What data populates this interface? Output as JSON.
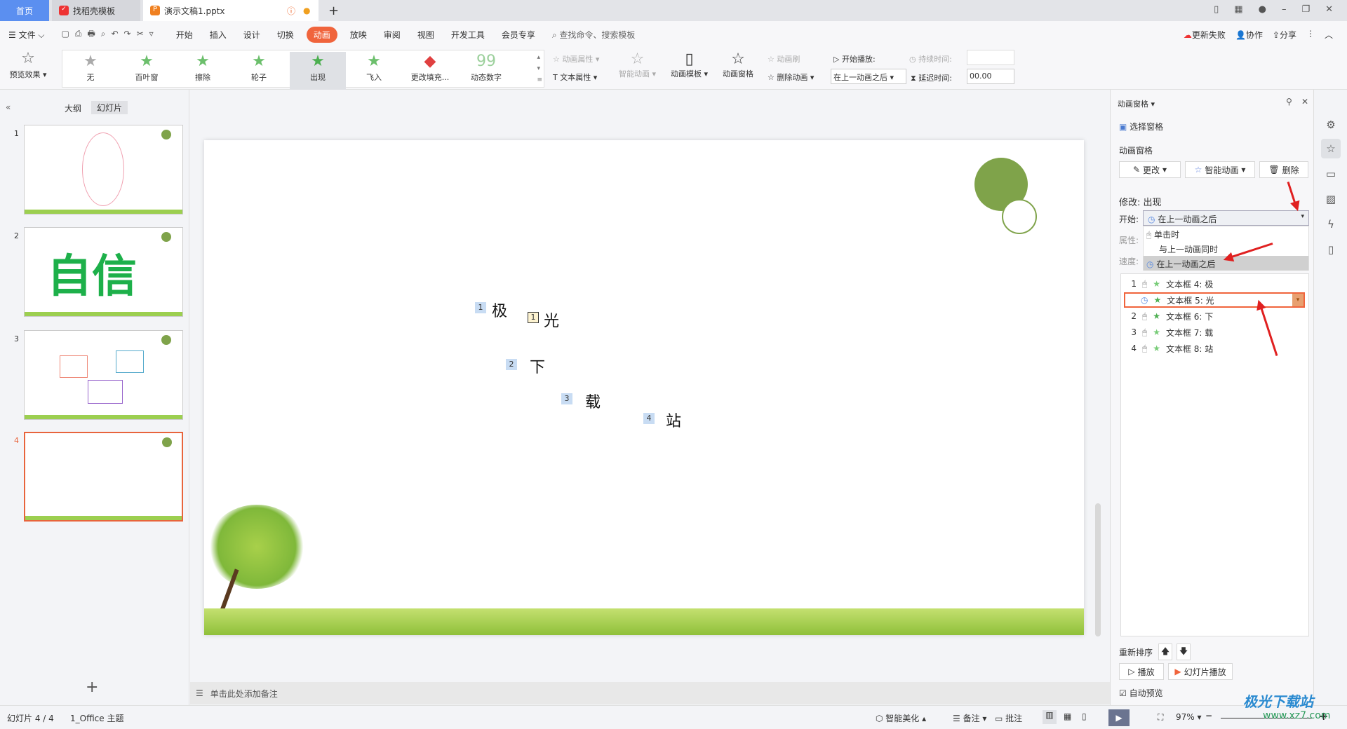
{
  "tabs": [
    {
      "label": "首页"
    },
    {
      "label": "找稻壳模板"
    },
    {
      "label": "演示文稿1.pptx"
    }
  ],
  "menu": {
    "file": "文件",
    "items": [
      "开始",
      "插入",
      "设计",
      "切换",
      "动画",
      "放映",
      "审阅",
      "视图",
      "开发工具",
      "会员专享"
    ],
    "active": "动画",
    "search_placeholder": "查找命令、搜索模板",
    "update": "更新失败",
    "collab": "协作",
    "share": "分享"
  },
  "ribbon": {
    "preview": "预览效果",
    "effects": [
      {
        "label": "无",
        "icon": "star-grey"
      },
      {
        "label": "百叶窗",
        "icon": "star-green"
      },
      {
        "label": "擦除",
        "icon": "star-green"
      },
      {
        "label": "轮子",
        "icon": "star-green"
      },
      {
        "label": "出现",
        "icon": "star-green"
      },
      {
        "label": "飞入",
        "icon": "star-green"
      },
      {
        "label": "更改填充...",
        "icon": "fill"
      },
      {
        "label": "动态数字",
        "icon": "99"
      }
    ],
    "anim_props": "动画属性",
    "text_props": "文本属性",
    "smart_anim": "智能动画",
    "anim_template": "动画模板",
    "anim_pane": "动画窗格",
    "anim_brush": "动画刷",
    "delete_anim": "删除动画",
    "start_play": "开始播放:",
    "start_value": "在上一动画之后",
    "duration": "持续时间:",
    "delay": "延迟时间:",
    "delay_value": "00.00"
  },
  "left": {
    "tab_outline": "大纲",
    "tab_slides": "幻灯片",
    "slides": [
      "1",
      "2",
      "3",
      "4"
    ],
    "slide2_text": "自信",
    "selected": 4
  },
  "slide": {
    "chars": [
      "极",
      "光",
      "下",
      "载",
      "站"
    ],
    "badges": [
      "1",
      "1",
      "2",
      "3",
      "4"
    ]
  },
  "notes_placeholder": "单击此处添加备注",
  "status": {
    "slide": "幻灯片 4 / 4",
    "theme": "1_Office 主题",
    "beautify": "智能美化",
    "notes": "备注",
    "comment": "批注",
    "zoom": "97%"
  },
  "pane": {
    "title": "动画窗格",
    "select_pane": "选择窗格",
    "section": "动画窗格",
    "change": "更改",
    "smart": "智能动画",
    "delete": "删除",
    "modify": "修改: 出现",
    "start_label": "开始:",
    "start_value": "在上一动画之后",
    "prop_label": "属性:",
    "speed_label": "速度:",
    "options": [
      "单击时",
      "与上一动画同时",
      "在上一动画之后"
    ],
    "list": [
      {
        "num": "1",
        "trigger": "click",
        "name": "文本框 4: 极"
      },
      {
        "num": "",
        "trigger": "after",
        "name": "文本框 5: 光"
      },
      {
        "num": "2",
        "trigger": "click",
        "name": "文本框 6: 下"
      },
      {
        "num": "3",
        "trigger": "click",
        "name": "文本框 7: 载"
      },
      {
        "num": "4",
        "trigger": "click",
        "name": "文本框 8: 站"
      }
    ],
    "reorder": "重新排序",
    "play": "播放",
    "slideshow": "幻灯片播放",
    "auto_preview": "自动预览"
  },
  "watermark": {
    "text": "极光下载站",
    "url": "www.xz7.com"
  },
  "colors": {
    "accent": "#f0643c",
    "green": "#7fa34a",
    "arrow": "#e02020"
  }
}
